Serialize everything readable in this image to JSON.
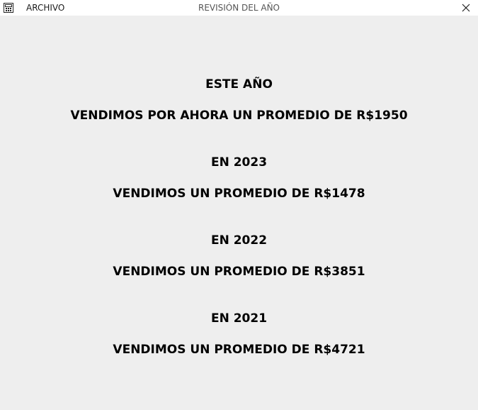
{
  "app_icon": "calculator-icon",
  "menu": {
    "archivo": "ARCHIVO"
  },
  "window": {
    "title": "REVISIÓN DEL AÑO",
    "close_icon": "close-icon"
  },
  "summary": {
    "current": {
      "heading": "ESTE AÑO",
      "text": "VENDIMOS POR AHORA UN PROMEDIO DE R$1950"
    },
    "years": [
      {
        "heading": "EN 2023",
        "text": "VENDIMOS UN PROMEDIO DE R$1478"
      },
      {
        "heading": "EN 2022",
        "text": "VENDIMOS UN PROMEDIO DE R$3851"
      },
      {
        "heading": "EN 2021",
        "text": "VENDIMOS UN PROMEDIO DE R$4721"
      }
    ]
  }
}
